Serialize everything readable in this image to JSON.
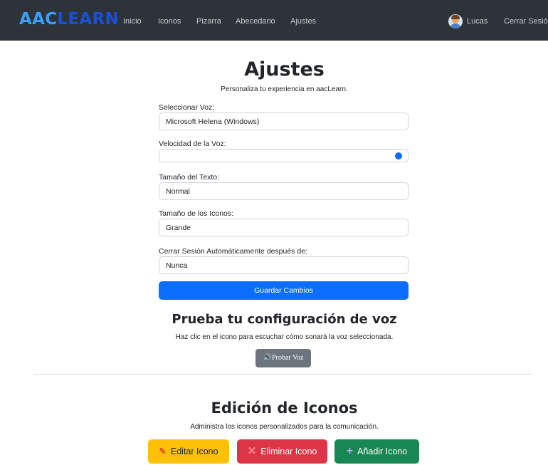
{
  "nav": {
    "brand_part1": "AAC",
    "brand_part2": "LEARN",
    "links": [
      "Inicio",
      "Iconos",
      "Pizarra",
      "Abecedario",
      "Ajustes"
    ],
    "user_name": "Lucas",
    "logout": "Cerrar Sesión"
  },
  "settings": {
    "title": "Ajustes",
    "subtitle": "Personaliza tu experiencia en aacLearn.",
    "voice_label": "Seleccionar Voz:",
    "voice_value": "Microsoft Helena (Windows)",
    "speed_label": "Velocidad de la Voz:",
    "speed_value": 1.0,
    "text_size_label": "Tamaño del Texto:",
    "text_size_value": "Normal",
    "icon_size_label": "Tamaño de los Iconos:",
    "icon_size_value": "Grande",
    "auto_logout_label": "Cerrar Sesión Automáticamente después de:",
    "auto_logout_value": "Nunca",
    "save_button": "Guardar Cambios"
  },
  "voice_test": {
    "title": "Prueba tu configuración de voz",
    "subtitle": "Haz clic en el icono para escuchar cómo sonará la voz seleccionada.",
    "button_icon": "speaker-icon",
    "button_label": "Probar Voz"
  },
  "icon_editing": {
    "title": "Edición de Iconos",
    "subtitle": "Administra los iconos personalizados para la comunicación.",
    "edit_label": "Editar Icono",
    "edit_icon": "pencil-icon",
    "delete_label": "Eliminar Icono",
    "delete_icon": "cross-icon",
    "add_label": "Añadir Icono",
    "add_icon": "plus-icon"
  },
  "colors": {
    "navbar": "#2d3339",
    "primary": "#0d6efd",
    "secondary": "#6c757d",
    "warning": "#ffc107",
    "danger": "#dc3545",
    "success": "#198754"
  }
}
